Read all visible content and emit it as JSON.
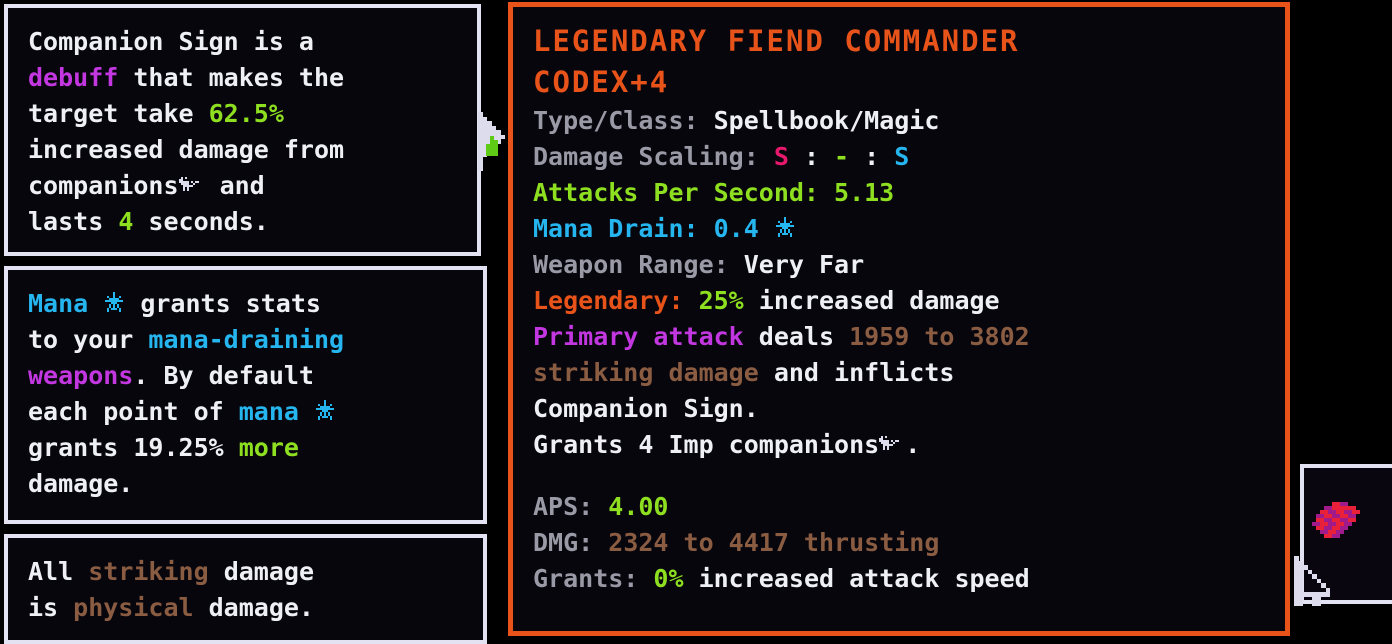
{
  "theme": {
    "background": "#000000",
    "panel_bg": "#08060d",
    "panel_border_light": "#e2e2f2",
    "panel_border_accent": "#e8531a",
    "text_white": "#eef0f6",
    "text_grey": "#9a9aa6",
    "green": "#8ddf20",
    "magenta": "#c237e0",
    "pink": "#e8186d",
    "blue": "#26b6ef",
    "orange": "#e8531a",
    "brown": "#8a5c42"
  },
  "tooltips": {
    "companion_sign": {
      "lines": [
        [
          {
            "t": "Companion Sign is a",
            "c": "white"
          }
        ],
        [
          {
            "t": "debuff",
            "c": "magenta"
          },
          {
            "t": " that makes the",
            "c": "white"
          }
        ],
        [
          {
            "t": "target take ",
            "c": "white"
          },
          {
            "t": "62.5%",
            "c": "green"
          }
        ],
        [
          {
            "t": "increased damage from",
            "c": "white"
          }
        ],
        [
          {
            "t": "companions",
            "c": "white"
          },
          {
            "icon": "companion-dog-icon"
          },
          {
            "t": " and",
            "c": "white"
          }
        ],
        [
          {
            "t": "lasts ",
            "c": "white"
          },
          {
            "t": "4",
            "c": "green"
          },
          {
            "t": " seconds.",
            "c": "white"
          }
        ]
      ]
    },
    "mana": {
      "lines": [
        [
          {
            "t": "Mana ",
            "c": "blue"
          },
          {
            "icon": "mana-star-icon"
          },
          {
            "t": " grants stats",
            "c": "white"
          }
        ],
        [
          {
            "t": "to your ",
            "c": "white"
          },
          {
            "t": "mana-draining",
            "c": "blue"
          }
        ],
        [
          {
            "t": "weapons",
            "c": "magenta"
          },
          {
            "t": ". By default",
            "c": "white"
          }
        ],
        [
          {
            "t": "each point of ",
            "c": "white"
          },
          {
            "t": "mana ",
            "c": "blue"
          },
          {
            "icon": "mana-star-icon"
          }
        ],
        [
          {
            "t": "grants 19.25% ",
            "c": "white"
          },
          {
            "t": "more",
            "c": "green"
          }
        ],
        [
          {
            "t": "damage.",
            "c": "white"
          }
        ]
      ]
    },
    "striking": {
      "lines": [
        [
          {
            "t": "All ",
            "c": "white"
          },
          {
            "t": "striking",
            "c": "brown"
          },
          {
            "t": " damage",
            "c": "white"
          }
        ],
        [
          {
            "t": "is ",
            "c": "white"
          },
          {
            "t": "physical",
            "c": "brown"
          },
          {
            "t": " damage.",
            "c": "white"
          }
        ]
      ]
    }
  },
  "item": {
    "title_line_1": "LEGENDARY FIEND COMMANDER",
    "title_line_2": "CODEX+4",
    "stats": [
      {
        "label": "Type/Class:",
        "label_color": "grey",
        "value": "Spellbook/Magic",
        "value_color": "white"
      },
      {
        "label": "Damage Scaling:",
        "label_color": "grey",
        "scaling": [
          {
            "t": "S",
            "c": "pink"
          },
          {
            "t": ":",
            "c": "white"
          },
          {
            "t": "-",
            "c": "green"
          },
          {
            "t": ":",
            "c": "white"
          },
          {
            "t": "S",
            "c": "blue"
          }
        ]
      },
      {
        "label": "Attacks Per Second:",
        "label_color": "green",
        "value": "5.13",
        "value_color": "green"
      },
      {
        "label": "Mana Drain:",
        "label_color": "blue",
        "value": "0.4",
        "value_color": "blue",
        "icon": "mana-star-icon"
      },
      {
        "label": "Weapon Range:",
        "label_color": "grey",
        "value": "Very Far",
        "value_color": "white"
      },
      {
        "label": "Legendary:",
        "label_color": "orange",
        "value_pre": "25%",
        "value_pre_color": "green",
        "value": "increased damage",
        "value_color": "white"
      }
    ],
    "description": [
      [
        {
          "t": "Primary attack",
          "c": "magenta"
        },
        {
          "t": " deals ",
          "c": "white"
        },
        {
          "t": "1959",
          "c": "brown"
        },
        {
          "t": " to ",
          "c": "brown"
        },
        {
          "t": "3802",
          "c": "brown"
        }
      ],
      [
        {
          "t": "striking damage",
          "c": "brown"
        },
        {
          "t": " and inflicts",
          "c": "white"
        }
      ],
      [
        {
          "t": "Companion Sign.",
          "c": "white"
        }
      ],
      [
        {
          "t": "Grants 4 Imp companions",
          "c": "white"
        },
        {
          "icon": "companion-dog-icon"
        },
        {
          "t": ".",
          "c": "white"
        }
      ]
    ],
    "summary": [
      [
        {
          "t": "APS: ",
          "c": "grey"
        },
        {
          "t": "4.00",
          "c": "green"
        }
      ],
      [
        {
          "t": "DMG: ",
          "c": "grey"
        },
        {
          "t": "2324 to 4417 thrusting",
          "c": "brown"
        }
      ],
      [
        {
          "t": "Grants: ",
          "c": "grey"
        },
        {
          "t": "0%",
          "c": "green"
        },
        {
          "t": " increased attack speed",
          "c": "white"
        }
      ]
    ]
  },
  "inventory": {
    "slot_item_name": "codex-item-icon",
    "slot_item_color": "#e8203a"
  },
  "cursor": {
    "name": "mouse-pointer"
  }
}
